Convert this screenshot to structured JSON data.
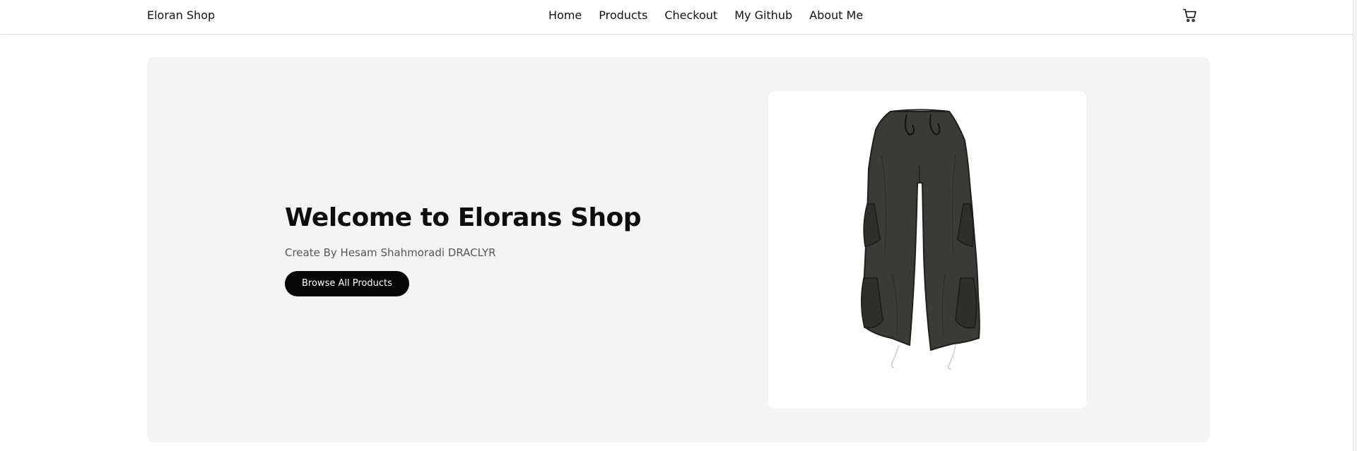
{
  "navbar": {
    "brand": "Eloran Shop",
    "links": [
      {
        "label": "Home"
      },
      {
        "label": "Products"
      },
      {
        "label": "Checkout"
      },
      {
        "label": "My Github"
      },
      {
        "label": "About Me"
      }
    ],
    "cart_icon": "shopping-cart-icon"
  },
  "hero": {
    "title": "Welcome to Elorans Shop",
    "subtitle": "Create By Hesam Shahmoradi DRACLYR",
    "button_label": "Browse All Products",
    "product_image": "cargo-pants-image"
  },
  "colors": {
    "hero_background": "#f4f4f4",
    "button_background": "#050505",
    "button_text": "#ffffff",
    "pants": "#3a3b36"
  }
}
